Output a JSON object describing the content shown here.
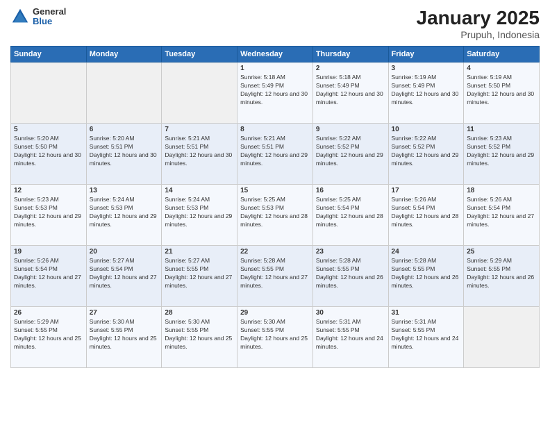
{
  "logo": {
    "general": "General",
    "blue": "Blue"
  },
  "title": "January 2025",
  "subtitle": "Prupuh, Indonesia",
  "days_of_week": [
    "Sunday",
    "Monday",
    "Tuesday",
    "Wednesday",
    "Thursday",
    "Friday",
    "Saturday"
  ],
  "weeks": [
    [
      {
        "day": "",
        "info": ""
      },
      {
        "day": "",
        "info": ""
      },
      {
        "day": "",
        "info": ""
      },
      {
        "day": "1",
        "info": "Sunrise: 5:18 AM\nSunset: 5:49 PM\nDaylight: 12 hours and 30 minutes."
      },
      {
        "day": "2",
        "info": "Sunrise: 5:18 AM\nSunset: 5:49 PM\nDaylight: 12 hours and 30 minutes."
      },
      {
        "day": "3",
        "info": "Sunrise: 5:19 AM\nSunset: 5:49 PM\nDaylight: 12 hours and 30 minutes."
      },
      {
        "day": "4",
        "info": "Sunrise: 5:19 AM\nSunset: 5:50 PM\nDaylight: 12 hours and 30 minutes."
      }
    ],
    [
      {
        "day": "5",
        "info": "Sunrise: 5:20 AM\nSunset: 5:50 PM\nDaylight: 12 hours and 30 minutes."
      },
      {
        "day": "6",
        "info": "Sunrise: 5:20 AM\nSunset: 5:51 PM\nDaylight: 12 hours and 30 minutes."
      },
      {
        "day": "7",
        "info": "Sunrise: 5:21 AM\nSunset: 5:51 PM\nDaylight: 12 hours and 30 minutes."
      },
      {
        "day": "8",
        "info": "Sunrise: 5:21 AM\nSunset: 5:51 PM\nDaylight: 12 hours and 29 minutes."
      },
      {
        "day": "9",
        "info": "Sunrise: 5:22 AM\nSunset: 5:52 PM\nDaylight: 12 hours and 29 minutes."
      },
      {
        "day": "10",
        "info": "Sunrise: 5:22 AM\nSunset: 5:52 PM\nDaylight: 12 hours and 29 minutes."
      },
      {
        "day": "11",
        "info": "Sunrise: 5:23 AM\nSunset: 5:52 PM\nDaylight: 12 hours and 29 minutes."
      }
    ],
    [
      {
        "day": "12",
        "info": "Sunrise: 5:23 AM\nSunset: 5:53 PM\nDaylight: 12 hours and 29 minutes."
      },
      {
        "day": "13",
        "info": "Sunrise: 5:24 AM\nSunset: 5:53 PM\nDaylight: 12 hours and 29 minutes."
      },
      {
        "day": "14",
        "info": "Sunrise: 5:24 AM\nSunset: 5:53 PM\nDaylight: 12 hours and 29 minutes."
      },
      {
        "day": "15",
        "info": "Sunrise: 5:25 AM\nSunset: 5:53 PM\nDaylight: 12 hours and 28 minutes."
      },
      {
        "day": "16",
        "info": "Sunrise: 5:25 AM\nSunset: 5:54 PM\nDaylight: 12 hours and 28 minutes."
      },
      {
        "day": "17",
        "info": "Sunrise: 5:26 AM\nSunset: 5:54 PM\nDaylight: 12 hours and 28 minutes."
      },
      {
        "day": "18",
        "info": "Sunrise: 5:26 AM\nSunset: 5:54 PM\nDaylight: 12 hours and 27 minutes."
      }
    ],
    [
      {
        "day": "19",
        "info": "Sunrise: 5:26 AM\nSunset: 5:54 PM\nDaylight: 12 hours and 27 minutes."
      },
      {
        "day": "20",
        "info": "Sunrise: 5:27 AM\nSunset: 5:54 PM\nDaylight: 12 hours and 27 minutes."
      },
      {
        "day": "21",
        "info": "Sunrise: 5:27 AM\nSunset: 5:55 PM\nDaylight: 12 hours and 27 minutes."
      },
      {
        "day": "22",
        "info": "Sunrise: 5:28 AM\nSunset: 5:55 PM\nDaylight: 12 hours and 27 minutes."
      },
      {
        "day": "23",
        "info": "Sunrise: 5:28 AM\nSunset: 5:55 PM\nDaylight: 12 hours and 26 minutes."
      },
      {
        "day": "24",
        "info": "Sunrise: 5:28 AM\nSunset: 5:55 PM\nDaylight: 12 hours and 26 minutes."
      },
      {
        "day": "25",
        "info": "Sunrise: 5:29 AM\nSunset: 5:55 PM\nDaylight: 12 hours and 26 minutes."
      }
    ],
    [
      {
        "day": "26",
        "info": "Sunrise: 5:29 AM\nSunset: 5:55 PM\nDaylight: 12 hours and 25 minutes."
      },
      {
        "day": "27",
        "info": "Sunrise: 5:30 AM\nSunset: 5:55 PM\nDaylight: 12 hours and 25 minutes."
      },
      {
        "day": "28",
        "info": "Sunrise: 5:30 AM\nSunset: 5:55 PM\nDaylight: 12 hours and 25 minutes."
      },
      {
        "day": "29",
        "info": "Sunrise: 5:30 AM\nSunset: 5:55 PM\nDaylight: 12 hours and 25 minutes."
      },
      {
        "day": "30",
        "info": "Sunrise: 5:31 AM\nSunset: 5:55 PM\nDaylight: 12 hours and 24 minutes."
      },
      {
        "day": "31",
        "info": "Sunrise: 5:31 AM\nSunset: 5:55 PM\nDaylight: 12 hours and 24 minutes."
      },
      {
        "day": "",
        "info": ""
      }
    ]
  ]
}
